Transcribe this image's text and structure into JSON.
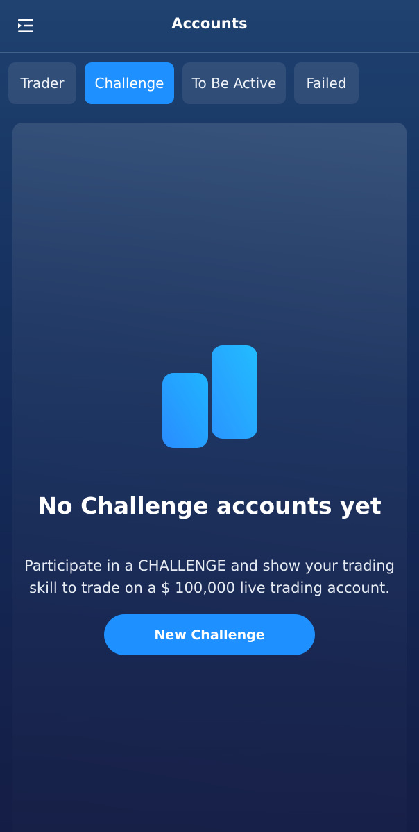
{
  "header": {
    "title": "Accounts",
    "menu_icon": "menu-collapse-icon"
  },
  "tabs": [
    {
      "label": "Trader",
      "active": false
    },
    {
      "label": "Challenge",
      "active": true
    },
    {
      "label": "To Be Active",
      "active": false
    },
    {
      "label": "Failed",
      "active": false
    }
  ],
  "empty_state": {
    "icon": "bar-chart-icon",
    "title": "No Challenge accounts yet",
    "description": "Participate in a CHALLENGE and show your trading skill to trade on a $ 100,000 live trading account.",
    "button_label": "New Challenge"
  },
  "colors": {
    "accent": "#1e90ff",
    "icon_gradient_start": "#2a8cff",
    "icon_gradient_end": "#1fb5ff"
  }
}
